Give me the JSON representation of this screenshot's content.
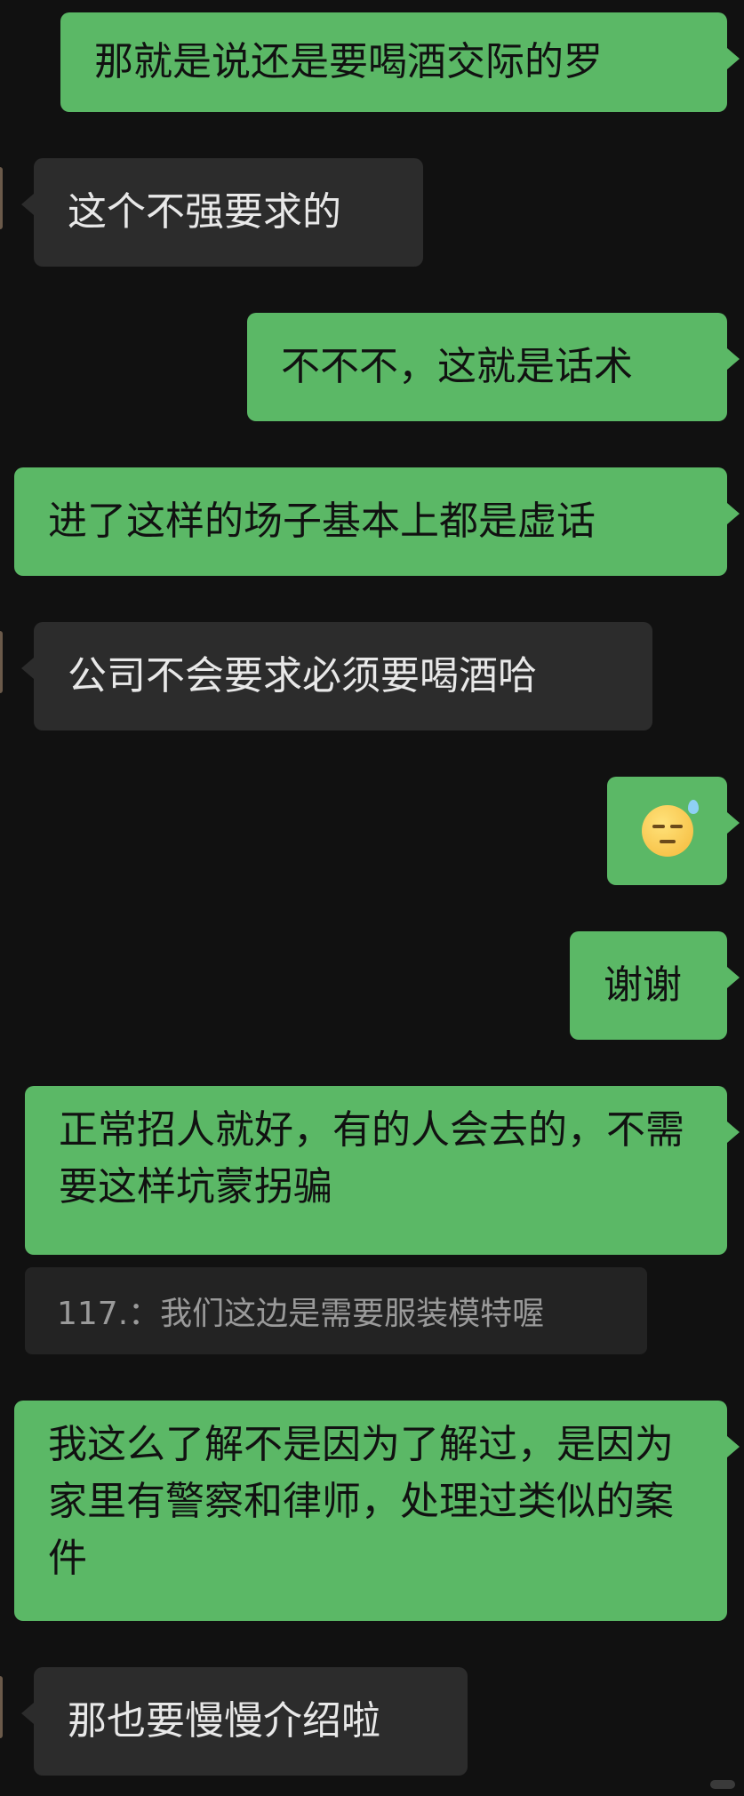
{
  "messages": [
    {
      "side": "out",
      "text": "那就是说还是要喝酒交际的罗"
    },
    {
      "side": "in",
      "text": "这个不强要求的"
    },
    {
      "side": "out",
      "text": "不不不，这就是话术"
    },
    {
      "side": "out",
      "text": "进了这样的场子基本上都是虚话"
    },
    {
      "side": "in",
      "text": "公司不会要求必须要喝酒哈"
    },
    {
      "side": "out",
      "emoji": "sweat-expressionless-emoji"
    },
    {
      "side": "out",
      "text": "谢谢"
    },
    {
      "side": "out",
      "text": "正常招人就好，有的人会去的，不需要这样坑蒙拐骗"
    },
    {
      "side": "out",
      "text": "我这么了解不是因为了解过，是因为家里有警察和律师，处理过类似的案件"
    },
    {
      "side": "in",
      "text": "那也要慢慢介绍啦"
    }
  ],
  "quote": {
    "text": "117.：我们这边是需要服装模特喔"
  },
  "colors": {
    "background": "#111111",
    "outgoing_bubble": "#5bb866",
    "incoming_bubble": "#2c2c2c",
    "quote_bubble": "#232323"
  }
}
